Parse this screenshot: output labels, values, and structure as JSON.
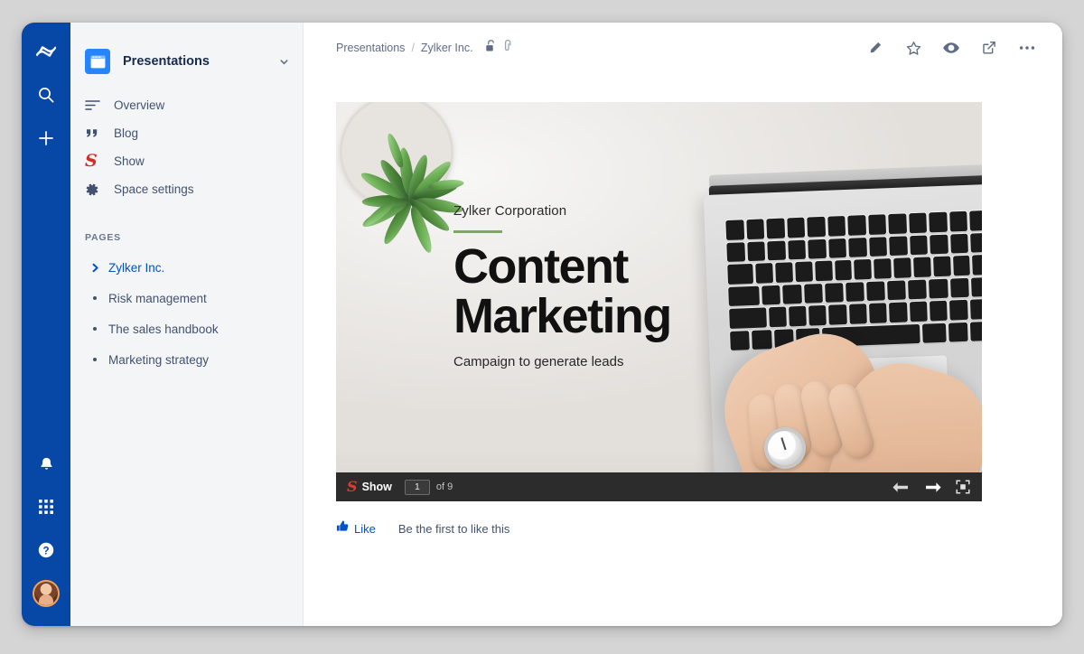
{
  "app_rail": {
    "items": [
      {
        "name": "confluence-logo",
        "label": "Confluence"
      },
      {
        "name": "search-icon",
        "label": "Search"
      },
      {
        "name": "create-icon",
        "label": "Create"
      }
    ],
    "bottom_items": [
      {
        "name": "notifications-bell-icon",
        "label": "Notifications"
      },
      {
        "name": "app-switcher-grid-icon",
        "label": "App switcher"
      },
      {
        "name": "help-icon",
        "label": "Help"
      },
      {
        "name": "user-avatar",
        "label": "Profile"
      }
    ]
  },
  "sidebar": {
    "space_title": "Presentations",
    "space_icon": "presentation-icon",
    "chevron": "chevron-down-icon",
    "nav_items": [
      {
        "label": "Overview",
        "icon": "overview-lines-icon"
      },
      {
        "label": "Blog",
        "icon": "quote-marks-icon"
      },
      {
        "label": "Show",
        "icon": "show-logo-icon"
      },
      {
        "label": "Space settings",
        "icon": "gear-icon"
      }
    ],
    "pages_label": "PAGES",
    "pages": [
      {
        "label": "Zylker Inc.",
        "marker": "chevron-right-icon",
        "active": true
      },
      {
        "label": "Risk management",
        "marker": "bullet",
        "active": false
      },
      {
        "label": "The sales handbook",
        "marker": "bullet",
        "active": false
      },
      {
        "label": "Marketing strategy",
        "marker": "bullet",
        "active": false
      }
    ]
  },
  "toolbar": {
    "breadcrumb": {
      "root": "Presentations",
      "separator": "/",
      "current": "Zylker Inc."
    },
    "breadcrumb_icons": [
      {
        "name": "unlock-icon"
      },
      {
        "name": "attachment-paperclip-icon"
      }
    ],
    "actions": [
      {
        "name": "edit-pencil-icon",
        "label": "Edit"
      },
      {
        "name": "star-icon",
        "label": "Watch"
      },
      {
        "name": "eye-icon",
        "label": "Preview"
      },
      {
        "name": "share-icon",
        "label": "Share"
      },
      {
        "name": "more-actions-icon",
        "label": "More actions"
      }
    ]
  },
  "slide": {
    "company": "Zylker Corporation",
    "headline_line1": "Content",
    "headline_line2": "Marketing",
    "subtitle": "Campaign to generate leads",
    "accent_rule_color": "#7ca862",
    "viewer": {
      "brand_mark": "S",
      "brand_name": "Show",
      "current_page": "1",
      "page_of": "of 9",
      "prev_icon": "arrow-left-icon",
      "next_icon": "arrow-right-icon",
      "fullscreen_icon": "fullscreen-icon"
    }
  },
  "like_row": {
    "icon": "thumbs-up-icon",
    "label": "Like",
    "status": "Be the first to like this"
  },
  "colors": {
    "rail_blue": "#0747a6",
    "sidebar_gray": "#f4f5f7",
    "link_blue": "#0052cc",
    "show_red": "#d32d27",
    "viewer_dark": "#2c2c2c"
  }
}
